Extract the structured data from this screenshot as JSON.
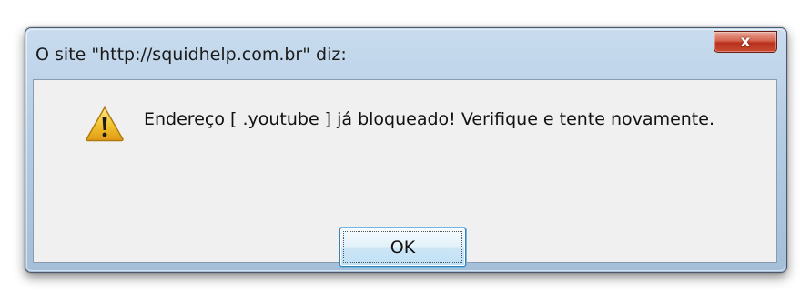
{
  "dialog": {
    "title": "O site \"http://squidhelp.com.br\" diz:",
    "close_icon": "close-icon",
    "close_glyph": "x",
    "warning_icon": "warning-icon",
    "message": "Endereço [ .youtube ] já bloqueado! Verifique e tente novamente.",
    "ok_label": "OK"
  },
  "colors": {
    "frame": "#b3cbe3",
    "client": "#f0f0f0",
    "close_button": "#c94a2f",
    "ok_border": "#3c7fb1",
    "warning_fill": "#f2c12e"
  }
}
